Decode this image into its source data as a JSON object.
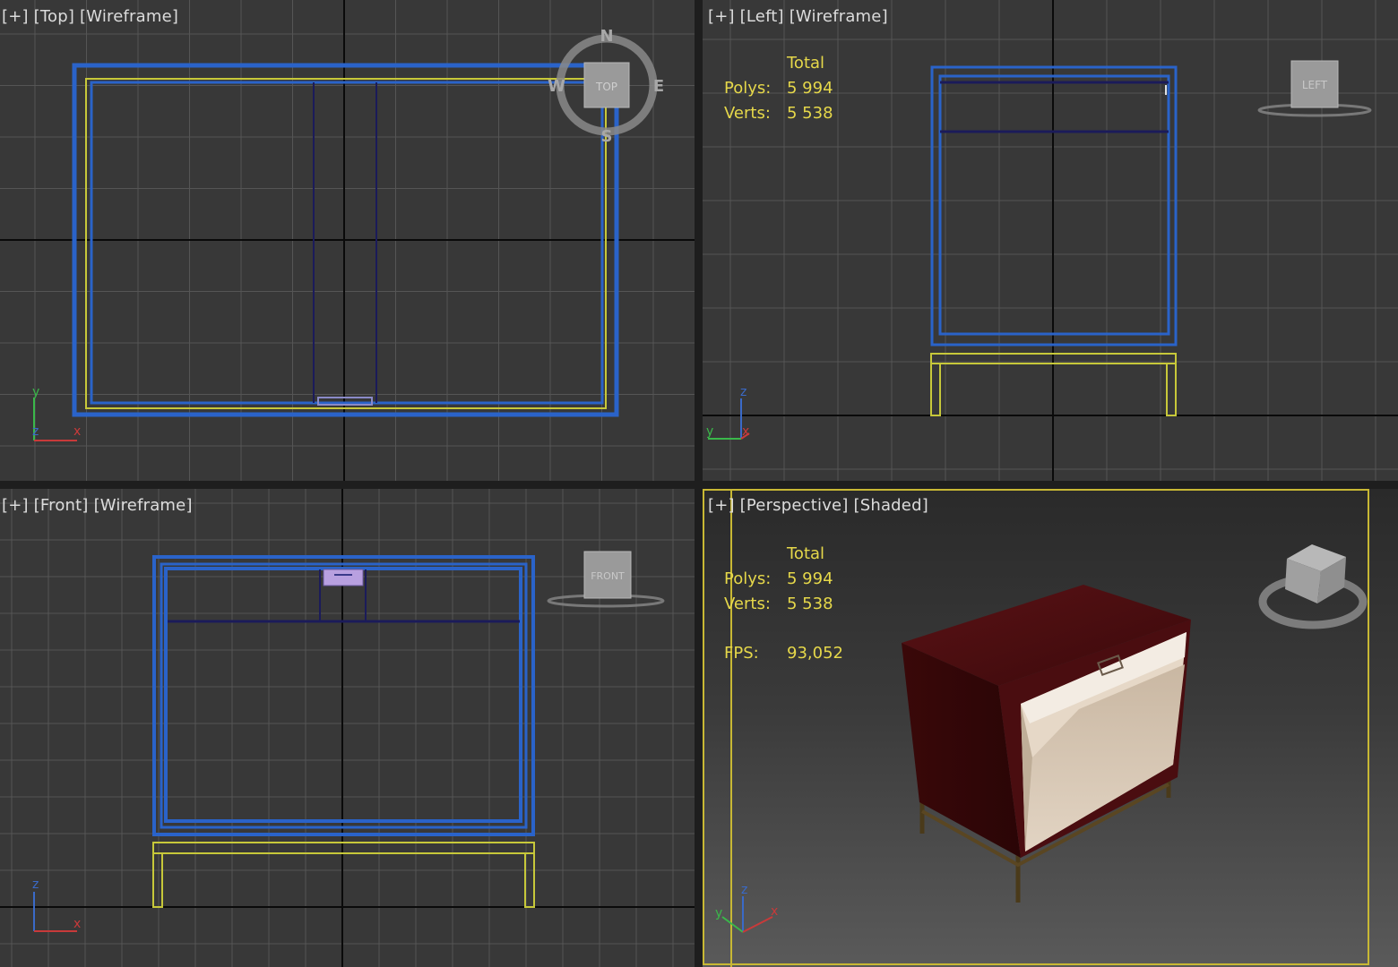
{
  "viewports": {
    "top": {
      "plus": "[+]",
      "view": "[Top]",
      "mode": "[Wireframe]"
    },
    "left": {
      "plus": "[+]",
      "view": "[Left]",
      "mode": "[Wireframe]"
    },
    "front": {
      "plus": "[+]",
      "view": "[Front]",
      "mode": "[Wireframe]"
    },
    "perspective": {
      "plus": "[+]",
      "view": "[Perspective]",
      "mode": "[Shaded]"
    }
  },
  "stats": {
    "total_label": "Total",
    "polys_label": "Polys:",
    "polys_value": "5 994",
    "verts_label": "Verts:",
    "verts_value": "5 538",
    "fps_label": "FPS:",
    "fps_value": "93,052"
  },
  "compass": {
    "n": "N",
    "s": "S",
    "e": "E",
    "w": "W",
    "cube_face": "TOP"
  },
  "viewcubes": {
    "left": "LEFT",
    "front": "FRONT"
  },
  "axes": {
    "x": "x",
    "y": "y",
    "z": "z"
  },
  "colors": {
    "viewport_bg": "#383838",
    "grid": "#555555",
    "home_grid": "#0a0a0a",
    "wire_blue": "#2a63c9",
    "wire_dark": "#1b1b5a",
    "wire_yellow": "#c7c83a",
    "stats_yellow": "#e6d84a",
    "active_border": "#c8b834",
    "wood": "#4a0d10",
    "interior": "#d9c9b4"
  }
}
